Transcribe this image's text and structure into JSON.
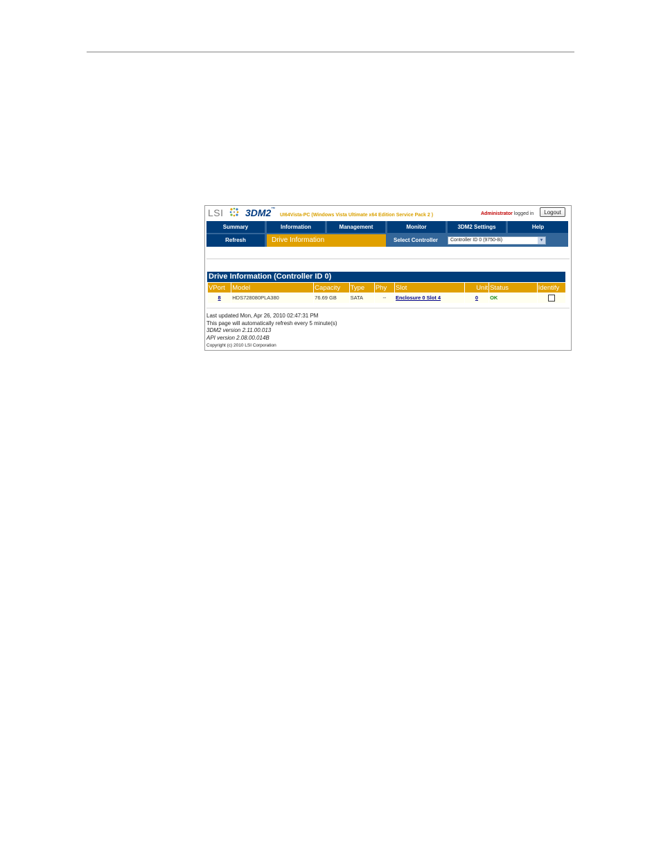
{
  "app": {
    "logo_company": "LSI",
    "logo_product": "3DM2",
    "logo_trademark": "™",
    "host_info": "UI64Vista-PC (Windows Vista Ultimate x64 Edition Service Pack 2 )",
    "user_role": "Administrator",
    "user_status": "logged in",
    "logout_label": "Logout"
  },
  "nav": {
    "tabs": [
      {
        "label": "Summary"
      },
      {
        "label": "Information"
      },
      {
        "label": "Management"
      },
      {
        "label": "Monitor"
      },
      {
        "label": "3DM2 Settings"
      },
      {
        "label": "Help"
      }
    ],
    "refresh_label": "Refresh",
    "current_page": "Drive Information",
    "select_controller_label": "Select Controller",
    "controller_selected": "Controller ID 0 (9750-8i)"
  },
  "section": {
    "title": "Drive Information (Controller ID 0)"
  },
  "table": {
    "columns": [
      "VPort",
      "Model",
      "Capacity",
      "Type",
      "Phy",
      "Slot",
      "Unit",
      "Status",
      "Identify"
    ],
    "rows": [
      {
        "vport": "8",
        "model": "HDS728080PLA380",
        "capacity": "76.69 GB",
        "type": "SATA",
        "phy": "--",
        "slot": "Enclosure 0 Slot 4",
        "unit": "0",
        "status": "OK",
        "identify_checked": false
      }
    ]
  },
  "footer": {
    "last_updated": "Last updated Mon, Apr 26, 2010 02:47:31 PM",
    "refresh_note": "This page will automatically refresh every 5 minute(s)",
    "version_3dm2": "3DM2 version 2.11.00.013",
    "version_api": "API version 2.08.00.014B",
    "copyright": "Copyright (c) 2010 LSI Corporation"
  },
  "colors": {
    "nav_blue": "#003d7a",
    "nav_bar": "#336699",
    "accent_gold": "#e0a000",
    "status_ok": "#1a8a1a",
    "admin_red": "#c00000"
  }
}
